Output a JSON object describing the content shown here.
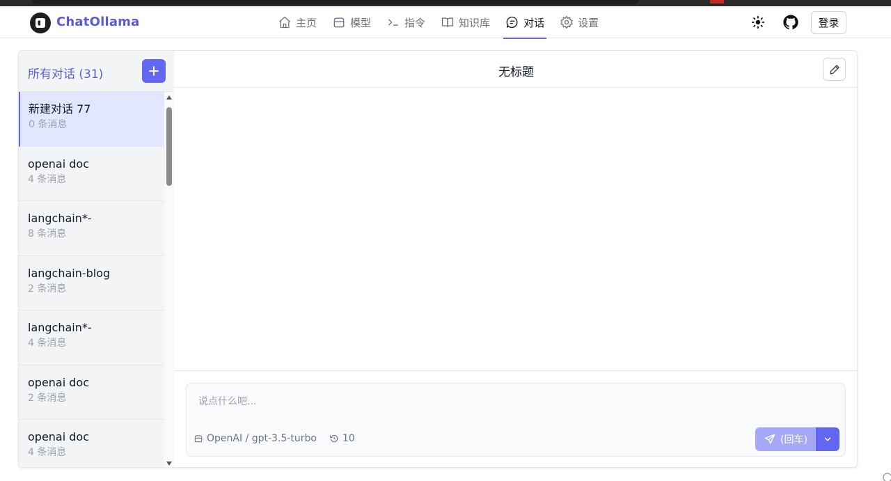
{
  "app": {
    "name": "ChatOllama"
  },
  "nav": {
    "items": [
      {
        "label": "主页",
        "icon": "home-icon"
      },
      {
        "label": "模型",
        "icon": "layers-icon"
      },
      {
        "label": "指令",
        "icon": "terminal-icon"
      },
      {
        "label": "知识库",
        "icon": "book-icon"
      },
      {
        "label": "对话",
        "icon": "chat-icon",
        "active": true
      },
      {
        "label": "设置",
        "icon": "gear-icon"
      }
    ]
  },
  "header_actions": {
    "login_label": "登录"
  },
  "sidebar": {
    "title": "所有对话 (31)",
    "conversations": [
      {
        "name": "新建对话 77",
        "count": "0 条消息",
        "active": true
      },
      {
        "name": "openai doc",
        "count": "4 条消息"
      },
      {
        "name": "langchain*-",
        "count": "8 条消息"
      },
      {
        "name": "langchain-blog",
        "count": "2 条消息"
      },
      {
        "name": "langchain*-",
        "count": "4 条消息"
      },
      {
        "name": "openai doc",
        "count": "2 条消息"
      },
      {
        "name": "openai doc",
        "count": "4 条消息"
      }
    ]
  },
  "chat": {
    "title": "无标题",
    "input_placeholder": "说点什么吧...",
    "input_value": "",
    "model": "OpenAI / gpt-3.5-turbo",
    "history_count": "10",
    "send_label": "(回车)"
  },
  "colors": {
    "accent": "#6366f1",
    "brand_text": "#5b5bd6",
    "active_item_bg": "#e0e7ff"
  }
}
